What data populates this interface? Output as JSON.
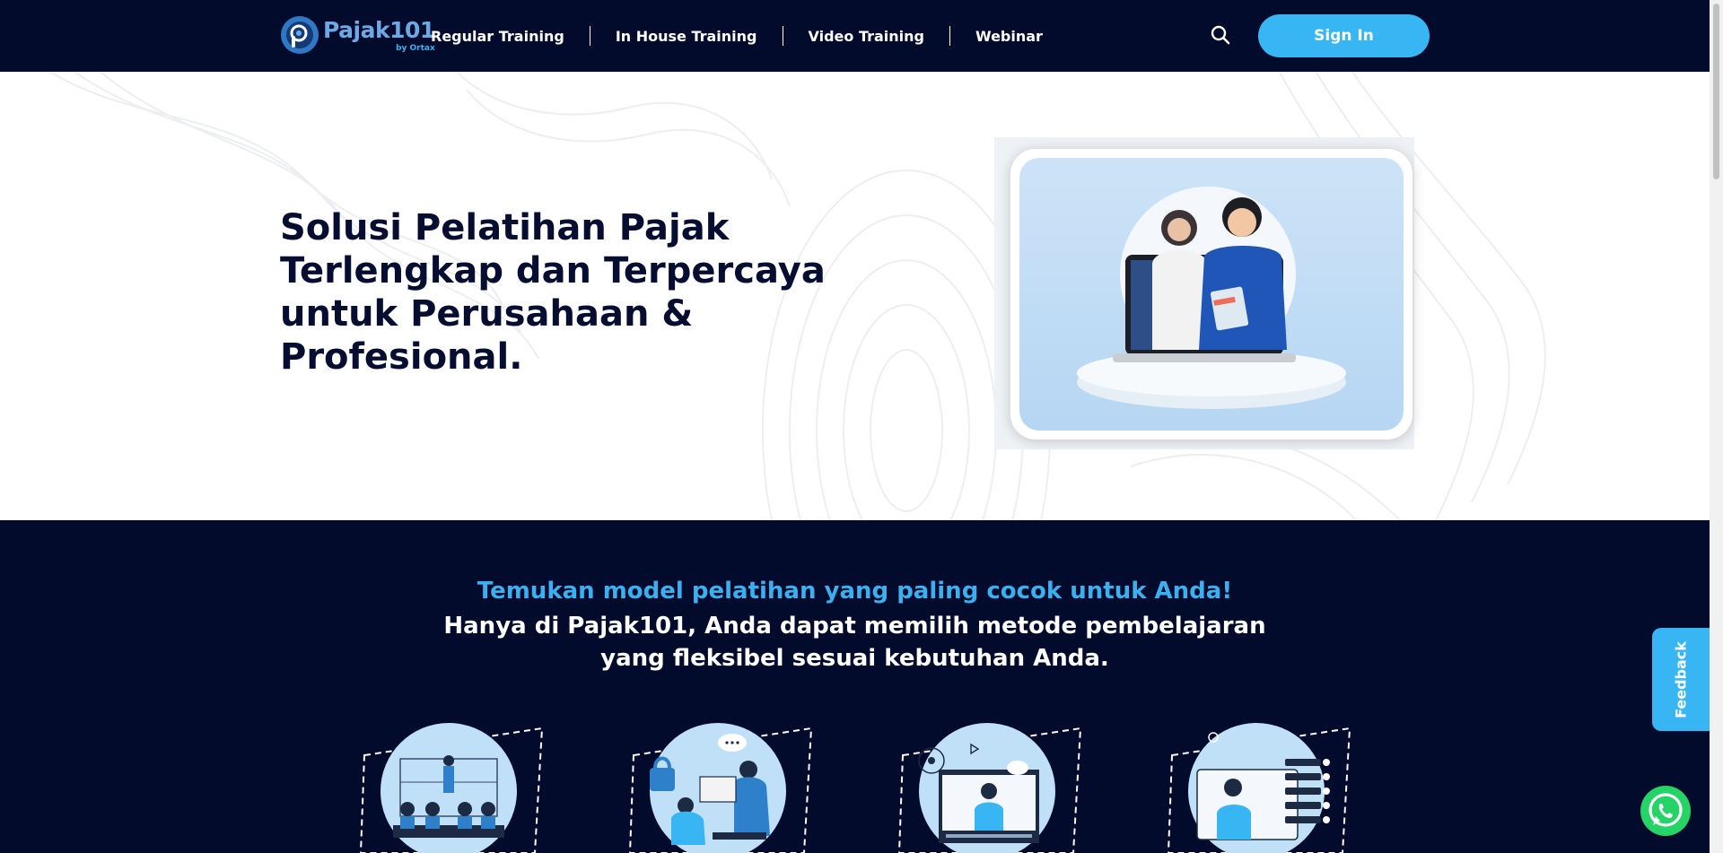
{
  "nav": {
    "logo_text": "Pajak101",
    "logo_sub": "by Ortax",
    "items": [
      {
        "label": "Regular Training"
      },
      {
        "label": "In House Training"
      },
      {
        "label": "Video Training"
      },
      {
        "label": "Webinar"
      }
    ],
    "search_icon": "search-icon",
    "signin_label": "Sign In"
  },
  "hero": {
    "title": "Solusi Pelatihan Pajak Terlengkap dan Terpercaya untuk Perusahaan & Profesional."
  },
  "section2": {
    "accent": "Temukan model pelatihan yang paling cocok untuk Anda!",
    "text": "Hanya di Pajak101, Anda dapat memilih metode pembelajaran yang fleksibel sesuai kebutuhan Anda."
  },
  "feedback_label": "Feedback",
  "colors": {
    "navy": "#030b2c",
    "accent": "#38b6f4",
    "light_blue": "#3bb0f0",
    "whatsapp": "#25d366"
  }
}
